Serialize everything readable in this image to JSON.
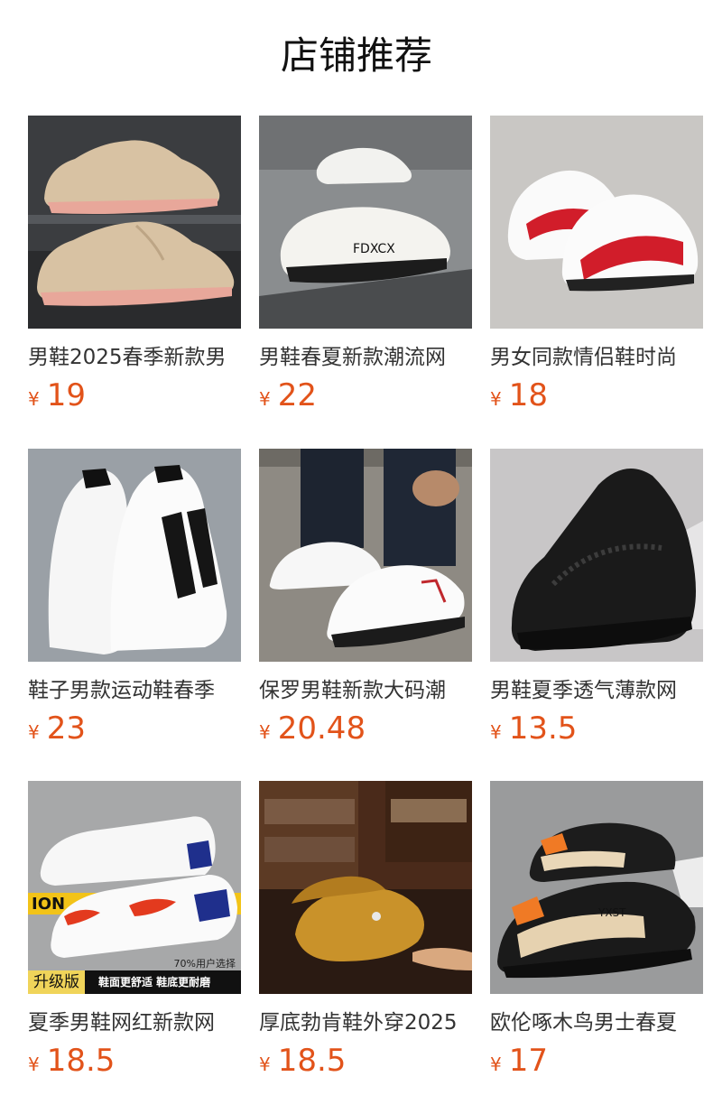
{
  "header": {
    "title": "店铺推荐"
  },
  "currency": "¥",
  "products": [
    {
      "name": "男鞋2025春季新款男",
      "price": "19",
      "image": "beige-mesh-sneakers"
    },
    {
      "name": "男鞋春夏新款潮流网",
      "price": "22",
      "image": "white-fdxcx-sneakers"
    },
    {
      "name": "男女同款情侣鞋时尚",
      "price": "18",
      "image": "white-red-sneakers"
    },
    {
      "name": "鞋子男款运动鞋春季",
      "price": "23",
      "image": "white-black-stripe-sneakers"
    },
    {
      "name": "保罗男鞋新款大码潮",
      "price": "20.48",
      "image": "white-leather-sneakers-worn"
    },
    {
      "name": "男鞋夏季透气薄款网",
      "price": "13.5",
      "image": "black-mesh-sneaker"
    },
    {
      "name": "夏季男鞋网红新款网",
      "price": "18.5",
      "image": "white-blue-red-sneakers",
      "badge": "升级版",
      "banner": "鞋面更舒适 鞋底更耐磨",
      "tag": "70%用户选择"
    },
    {
      "name": "厚底勃肯鞋外穿2025",
      "price": "18.5",
      "image": "tan-suede-clogs"
    },
    {
      "name": "欧伦啄木鸟男士春夏",
      "price": "17",
      "image": "black-beige-orange-sneakers"
    }
  ]
}
